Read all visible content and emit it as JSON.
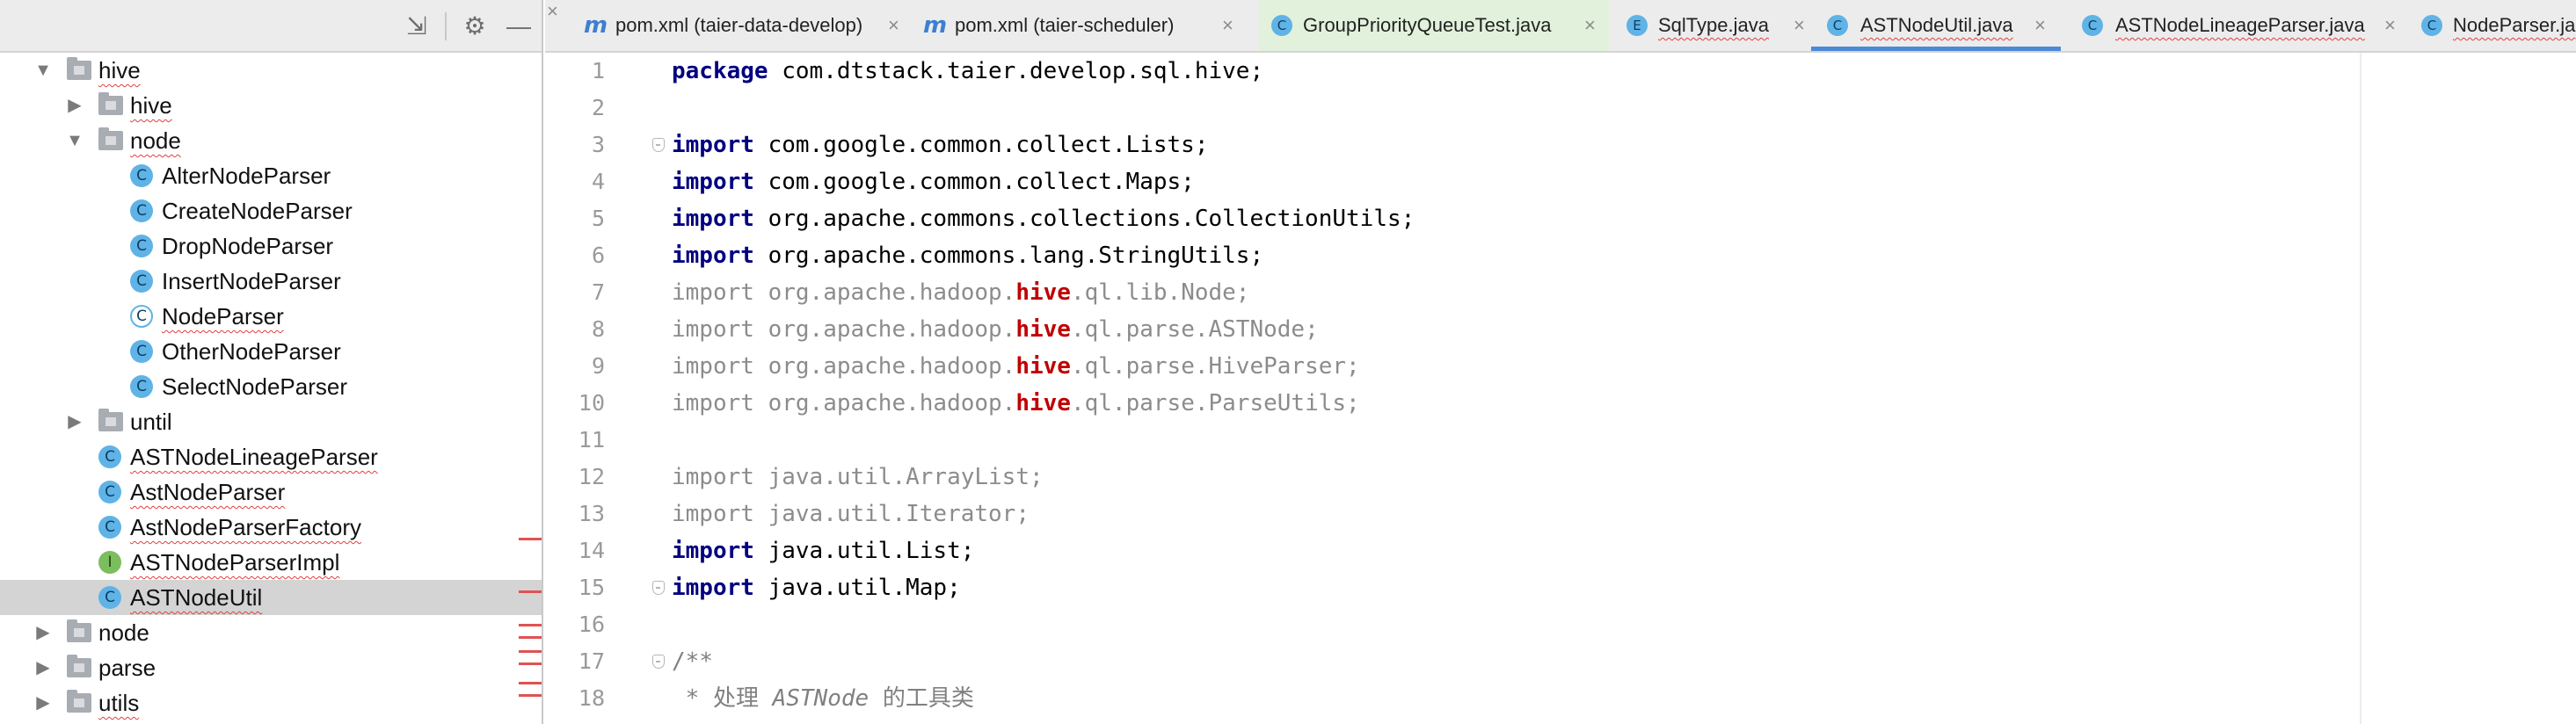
{
  "panel_toolbar": {
    "collapse_icon": "collapse-all-icon",
    "settings_icon": "gear-icon",
    "hide_icon": "minimize-icon"
  },
  "tree": {
    "items": [
      {
        "label": "hive",
        "type": "folder",
        "expanded": true
      },
      {
        "label": "hive",
        "type": "folder",
        "expanded": false
      },
      {
        "label": "node",
        "type": "folder",
        "expanded": true
      },
      {
        "label": "AlterNodeParser",
        "type": "class",
        "icon_letter": "C"
      },
      {
        "label": "CreateNodeParser",
        "type": "class",
        "icon_letter": "C"
      },
      {
        "label": "DropNodeParser",
        "type": "class",
        "icon_letter": "C"
      },
      {
        "label": "InsertNodeParser",
        "type": "class",
        "icon_letter": "C"
      },
      {
        "label": "NodeParser",
        "type": "abstract-class",
        "icon_letter": "C"
      },
      {
        "label": "OtherNodeParser",
        "type": "class",
        "icon_letter": "C"
      },
      {
        "label": "SelectNodeParser",
        "type": "class",
        "icon_letter": "C"
      },
      {
        "label": "until",
        "type": "folder",
        "expanded": false
      },
      {
        "label": "ASTNodeLineageParser",
        "type": "class",
        "icon_letter": "C"
      },
      {
        "label": "AstNodeParser",
        "type": "class",
        "icon_letter": "C"
      },
      {
        "label": "AstNodeParserFactory",
        "type": "class",
        "icon_letter": "C"
      },
      {
        "label": "ASTNodeParserImpl",
        "type": "interface",
        "icon_letter": "I"
      },
      {
        "label": "ASTNodeUtil",
        "type": "class",
        "icon_letter": "C",
        "selected": true
      },
      {
        "label": "node",
        "type": "folder",
        "expanded": false
      },
      {
        "label": "parse",
        "type": "folder",
        "expanded": false
      },
      {
        "label": "utils",
        "type": "folder",
        "expanded": false
      }
    ]
  },
  "tabs": [
    {
      "label": "pom.xml (taier-data-develop)",
      "icon": "maven-icon",
      "icon_letter": "m"
    },
    {
      "label": "pom.xml (taier-scheduler)",
      "icon": "maven-icon",
      "icon_letter": "m"
    },
    {
      "label": "GroupPriorityQueueTest.java",
      "icon": "class-icon",
      "icon_letter": "C"
    },
    {
      "label": "SqlType.java",
      "icon": "enum-icon",
      "icon_letter": "E"
    },
    {
      "label": "ASTNodeUtil.java",
      "icon": "class-icon",
      "icon_letter": "C",
      "active": true
    },
    {
      "label": "ASTNodeLineageParser.java",
      "icon": "class-icon",
      "icon_letter": "C"
    },
    {
      "label": "NodeParser.ja",
      "icon": "class-icon",
      "icon_letter": "C"
    }
  ],
  "tab_close_glyph": "×",
  "editor": {
    "line_numbers": [
      "1",
      "2",
      "3",
      "4",
      "5",
      "6",
      "7",
      "8",
      "9",
      "10",
      "11",
      "12",
      "13",
      "14",
      "15",
      "16",
      "17",
      "18"
    ],
    "lines": {
      "l1_kw": "package",
      "l1_rest": " com.dtstack.taier.develop.sql.hive;",
      "l3_kw": "import",
      "l3_rest": " com.google.common.collect.Lists;",
      "l4_kw": "import",
      "l4_rest": " com.google.common.collect.Maps;",
      "l5_kw": "import",
      "l5_rest": " org.apache.commons.collections.CollectionUtils;",
      "l6_kw": "import",
      "l6_rest": " org.apache.commons.lang.StringUtils;",
      "l7_kw": "import",
      "l7_a": " org.apache.hadoop.",
      "l7_hl": "hive",
      "l7_b": ".ql.lib.Node;",
      "l8_kw": "import",
      "l8_a": " org.apache.hadoop.",
      "l8_hl": "hive",
      "l8_b": ".ql.parse.ASTNode;",
      "l9_kw": "import",
      "l9_a": " org.apache.hadoop.",
      "l9_hl": "hive",
      "l9_b": ".ql.parse.HiveParser;",
      "l10_kw": "import",
      "l10_a": " org.apache.hadoop.",
      "l10_hl": "hive",
      "l10_b": ".ql.parse.ParseUtils;",
      "l12_kw": "import",
      "l12_rest": " java.util.ArrayList;",
      "l13_kw": "import",
      "l13_rest": " java.util.Iterator;",
      "l14_kw": "import",
      "l14_rest": " java.util.List;",
      "l15_kw": "import",
      "l15_rest": " java.util.Map;",
      "l17": "/**",
      "l18_a": " * 处理 ",
      "l18_b": "ASTNode",
      "l18_c": " 的工具类"
    }
  },
  "colors": {
    "keyword": "#000080",
    "highlight": "#c00000",
    "unused_import": "#8c8c8c",
    "active_tab_underline": "#4a8ad6",
    "selection": "#d4d4d4",
    "error_mark": "#e05252"
  }
}
